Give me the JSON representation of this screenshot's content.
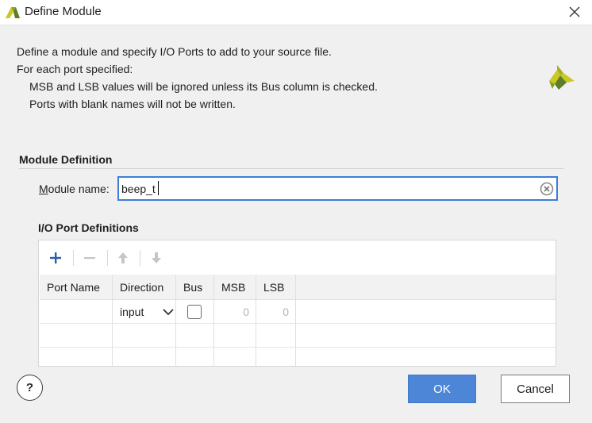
{
  "window": {
    "title": "Define Module"
  },
  "description": {
    "line1": "Define a module and specify I/O Ports to add to your source file.",
    "line2": "For each port specified:",
    "line3": "MSB and LSB values will be ignored unless its Bus column is checked.",
    "line4": "Ports with blank names will not be written."
  },
  "module_definition": {
    "section_title": "Module Definition",
    "label_underlined": "M",
    "label_rest": "odule name:",
    "value": "beep_t"
  },
  "io_ports": {
    "section_title": "I/O Port Definitions",
    "columns": [
      "Port Name",
      "Direction",
      "Bus",
      "MSB",
      "LSB"
    ],
    "rows": [
      {
        "port_name": "",
        "direction": "input",
        "bus": false,
        "msb": "0",
        "lsb": "0"
      }
    ]
  },
  "buttons": {
    "help": "?",
    "ok": "OK",
    "cancel": "Cancel"
  },
  "colors": {
    "accent": "#4d86d6",
    "focus_border": "#3d7ed8",
    "logo_yellow": "#c8c81e",
    "logo_green": "#6b8a2e"
  }
}
